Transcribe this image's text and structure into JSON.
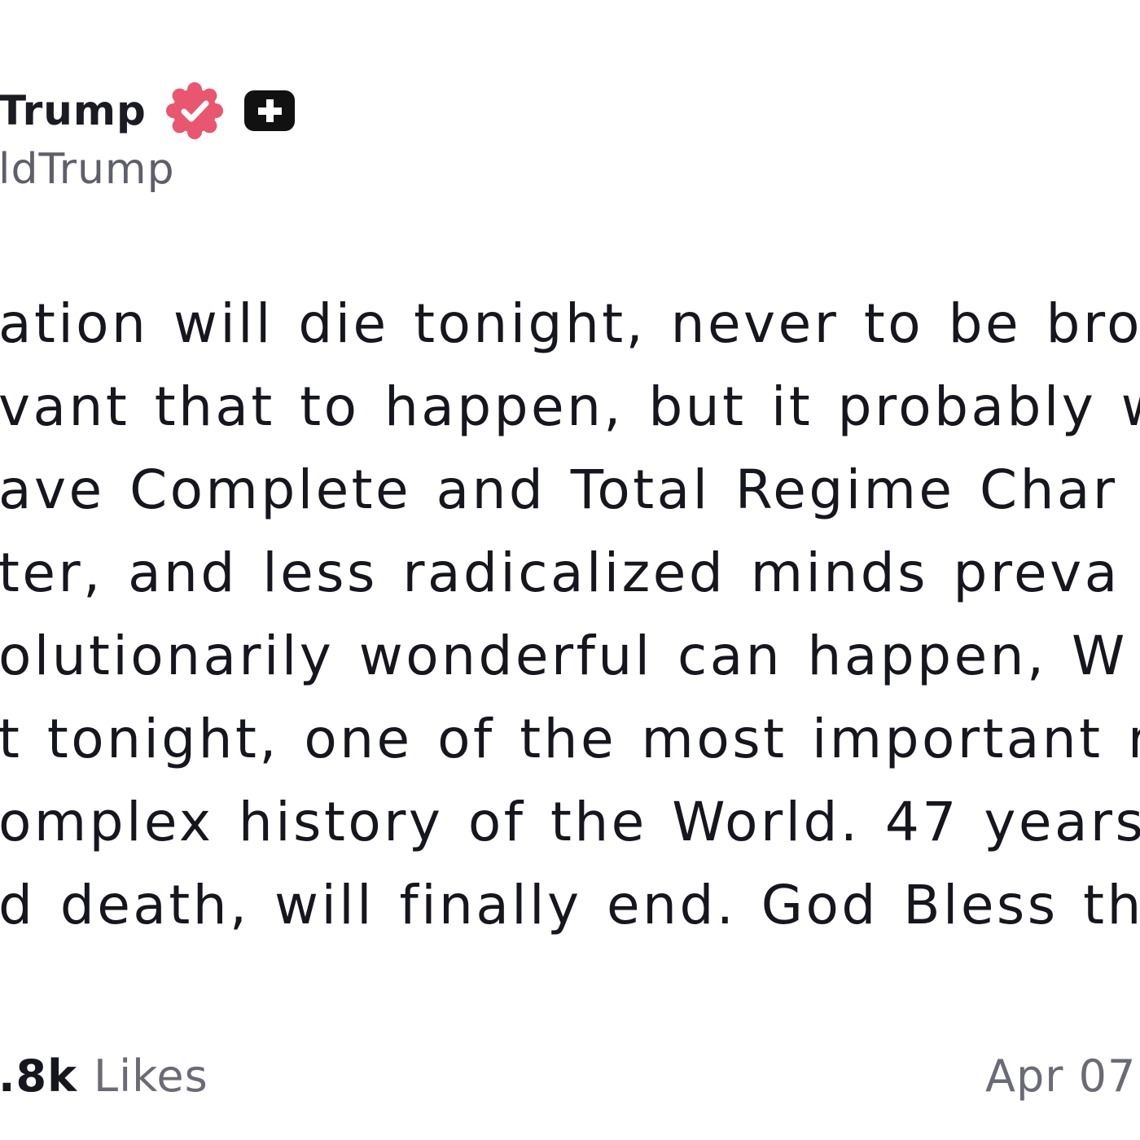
{
  "author": {
    "display_name": "Trump",
    "handle": "ldTrump",
    "verified_badge_color": "#e8566f",
    "plus_badge_color": "#111111"
  },
  "post": {
    "lines": [
      "ation will die tonight, never to be brou",
      "vant that to happen, but it probably w",
      "ave Complete and Total Regime Char",
      "ter, and less radicalized minds preva",
      "olutionarily wonderful can happen, W",
      "t tonight, one of the most important r",
      "omplex history of the World. 47 years",
      "d death, will finally end. God Bless the"
    ]
  },
  "footer": {
    "likes_count": ".8k",
    "likes_label": "Likes",
    "date": "Apr 07"
  }
}
